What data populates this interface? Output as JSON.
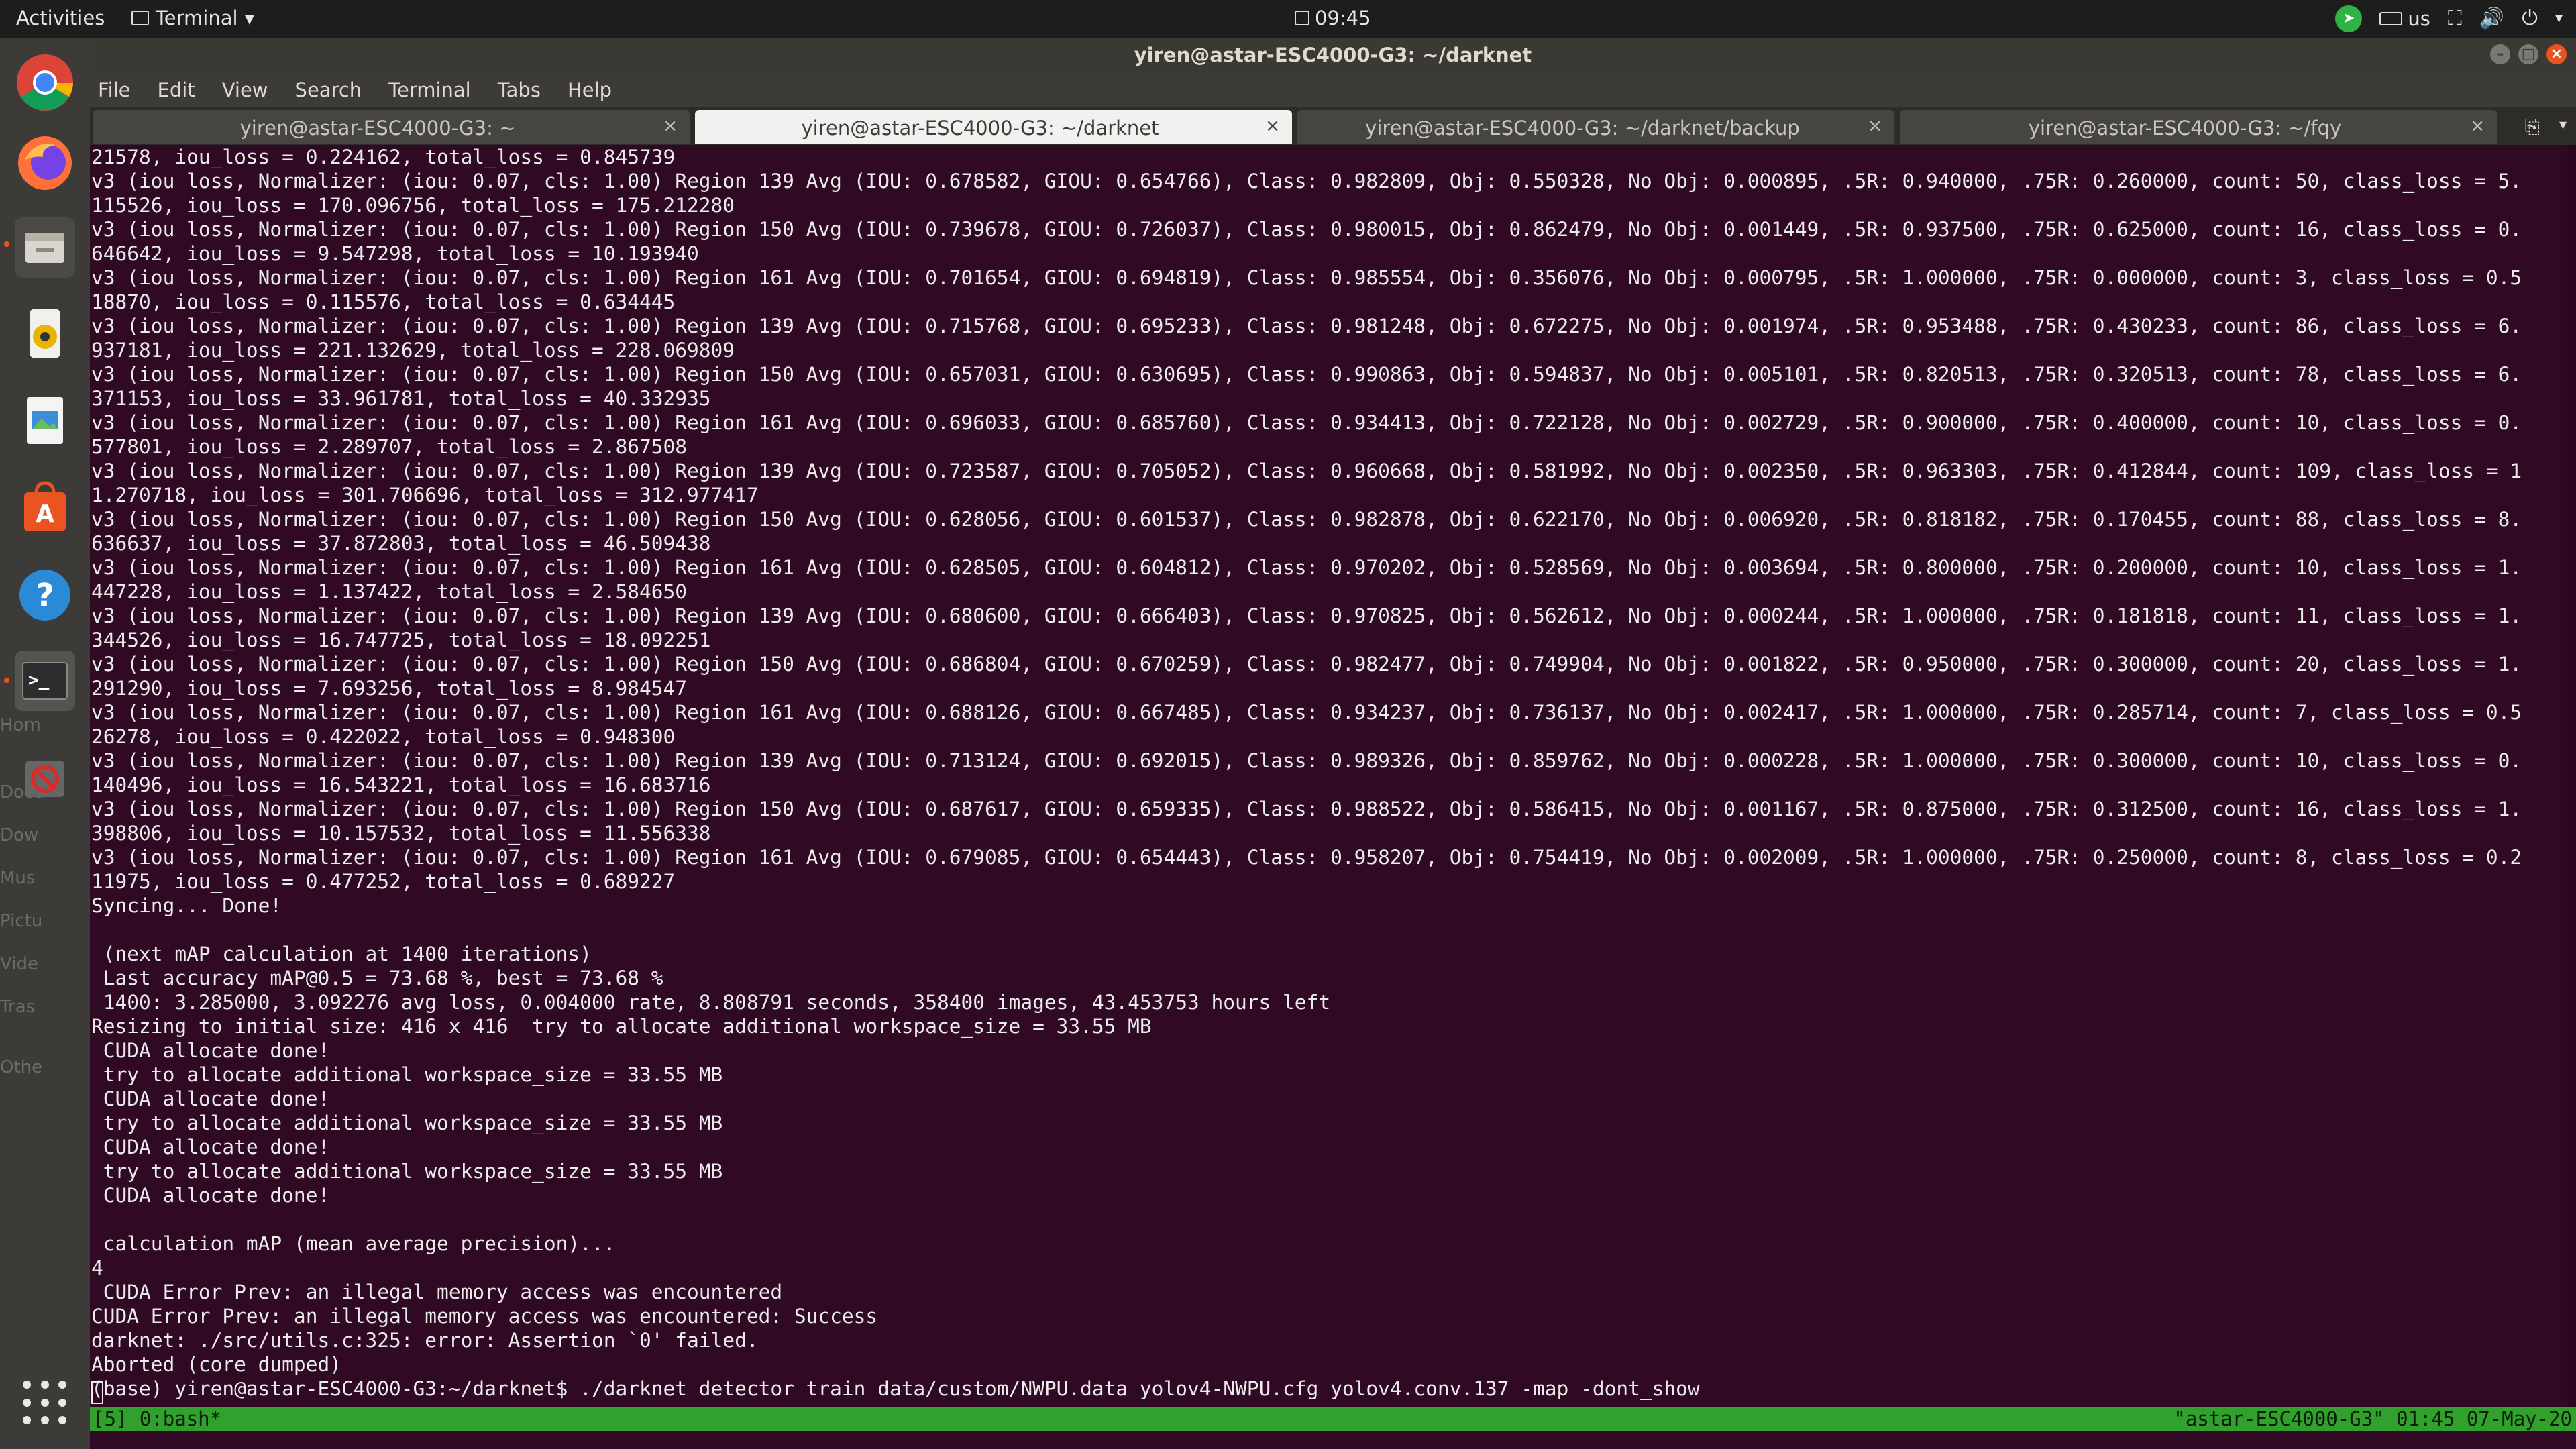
{
  "topbar": {
    "activities": "Activities",
    "app_menu": "Terminal",
    "clock": "09:45",
    "keyboard_layout": "us"
  },
  "dock": {
    "items": [
      "chrome-icon",
      "firefox-icon",
      "files-icon",
      "rhythmbox-icon",
      "image-viewer-icon",
      "software-center-icon",
      "help-icon",
      "terminal-icon",
      "blocked-icon"
    ],
    "ghost_labels": [
      "Hom",
      "Docu",
      "Dow",
      "Mus",
      "Pictu",
      "Vide",
      "Tras",
      "Othe"
    ]
  },
  "window": {
    "title": "yiren@astar-ESC4000-G3: ~/darknet",
    "menu": [
      "File",
      "Edit",
      "View",
      "Search",
      "Terminal",
      "Tabs",
      "Help"
    ],
    "tabs": [
      {
        "label": "yiren@astar-ESC4000-G3: ~",
        "active": false
      },
      {
        "label": "yiren@astar-ESC4000-G3: ~/darknet",
        "active": true
      },
      {
        "label": "yiren@astar-ESC4000-G3: ~/darknet/backup",
        "active": false
      },
      {
        "label": "yiren@astar-ESC4000-G3: ~/fqy",
        "active": false
      }
    ]
  },
  "terminal": {
    "lines": [
      "21578, iou_loss = 0.224162, total_loss = 0.845739",
      "v3 (iou loss, Normalizer: (iou: 0.07, cls: 1.00) Region 139 Avg (IOU: 0.678582, GIOU: 0.654766), Class: 0.982809, Obj: 0.550328, No Obj: 0.000895, .5R: 0.940000, .75R: 0.260000, count: 50, class_loss = 5.",
      "115526, iou_loss = 170.096756, total_loss = 175.212280",
      "v3 (iou loss, Normalizer: (iou: 0.07, cls: 1.00) Region 150 Avg (IOU: 0.739678, GIOU: 0.726037), Class: 0.980015, Obj: 0.862479, No Obj: 0.001449, .5R: 0.937500, .75R: 0.625000, count: 16, class_loss = 0.",
      "646642, iou_loss = 9.547298, total_loss = 10.193940",
      "v3 (iou loss, Normalizer: (iou: 0.07, cls: 1.00) Region 161 Avg (IOU: 0.701654, GIOU: 0.694819), Class: 0.985554, Obj: 0.356076, No Obj: 0.000795, .5R: 1.000000, .75R: 0.000000, count: 3, class_loss = 0.5",
      "18870, iou_loss = 0.115576, total_loss = 0.634445",
      "v3 (iou loss, Normalizer: (iou: 0.07, cls: 1.00) Region 139 Avg (IOU: 0.715768, GIOU: 0.695233), Class: 0.981248, Obj: 0.672275, No Obj: 0.001974, .5R: 0.953488, .75R: 0.430233, count: 86, class_loss = 6.",
      "937181, iou_loss = 221.132629, total_loss = 228.069809",
      "v3 (iou loss, Normalizer: (iou: 0.07, cls: 1.00) Region 150 Avg (IOU: 0.657031, GIOU: 0.630695), Class: 0.990863, Obj: 0.594837, No Obj: 0.005101, .5R: 0.820513, .75R: 0.320513, count: 78, class_loss = 6.",
      "371153, iou_loss = 33.961781, total_loss = 40.332935",
      "v3 (iou loss, Normalizer: (iou: 0.07, cls: 1.00) Region 161 Avg (IOU: 0.696033, GIOU: 0.685760), Class: 0.934413, Obj: 0.722128, No Obj: 0.002729, .5R: 0.900000, .75R: 0.400000, count: 10, class_loss = 0.",
      "577801, iou_loss = 2.289707, total_loss = 2.867508",
      "v3 (iou loss, Normalizer: (iou: 0.07, cls: 1.00) Region 139 Avg (IOU: 0.723587, GIOU: 0.705052), Class: 0.960668, Obj: 0.581992, No Obj: 0.002350, .5R: 0.963303, .75R: 0.412844, count: 109, class_loss = 1",
      "1.270718, iou_loss = 301.706696, total_loss = 312.977417",
      "v3 (iou loss, Normalizer: (iou: 0.07, cls: 1.00) Region 150 Avg (IOU: 0.628056, GIOU: 0.601537), Class: 0.982878, Obj: 0.622170, No Obj: 0.006920, .5R: 0.818182, .75R: 0.170455, count: 88, class_loss = 8.",
      "636637, iou_loss = 37.872803, total_loss = 46.509438",
      "v3 (iou loss, Normalizer: (iou: 0.07, cls: 1.00) Region 161 Avg (IOU: 0.628505, GIOU: 0.604812), Class: 0.970202, Obj: 0.528569, No Obj: 0.003694, .5R: 0.800000, .75R: 0.200000, count: 10, class_loss = 1.",
      "447228, iou_loss = 1.137422, total_loss = 2.584650",
      "v3 (iou loss, Normalizer: (iou: 0.07, cls: 1.00) Region 139 Avg (IOU: 0.680600, GIOU: 0.666403), Class: 0.970825, Obj: 0.562612, No Obj: 0.000244, .5R: 1.000000, .75R: 0.181818, count: 11, class_loss = 1.",
      "344526, iou_loss = 16.747725, total_loss = 18.092251",
      "v3 (iou loss, Normalizer: (iou: 0.07, cls: 1.00) Region 150 Avg (IOU: 0.686804, GIOU: 0.670259), Class: 0.982477, Obj: 0.749904, No Obj: 0.001822, .5R: 0.950000, .75R: 0.300000, count: 20, class_loss = 1.",
      "291290, iou_loss = 7.693256, total_loss = 8.984547",
      "v3 (iou loss, Normalizer: (iou: 0.07, cls: 1.00) Region 161 Avg (IOU: 0.688126, GIOU: 0.667485), Class: 0.934237, Obj: 0.736137, No Obj: 0.002417, .5R: 1.000000, .75R: 0.285714, count: 7, class_loss = 0.5",
      "26278, iou_loss = 0.422022, total_loss = 0.948300",
      "v3 (iou loss, Normalizer: (iou: 0.07, cls: 1.00) Region 139 Avg (IOU: 0.713124, GIOU: 0.692015), Class: 0.989326, Obj: 0.859762, No Obj: 0.000228, .5R: 1.000000, .75R: 0.300000, count: 10, class_loss = 0.",
      "140496, iou_loss = 16.543221, total_loss = 16.683716",
      "v3 (iou loss, Normalizer: (iou: 0.07, cls: 1.00) Region 150 Avg (IOU: 0.687617, GIOU: 0.659335), Class: 0.988522, Obj: 0.586415, No Obj: 0.001167, .5R: 0.875000, .75R: 0.312500, count: 16, class_loss = 1.",
      "398806, iou_loss = 10.157532, total_loss = 11.556338",
      "v3 (iou loss, Normalizer: (iou: 0.07, cls: 1.00) Region 161 Avg (IOU: 0.679085, GIOU: 0.654443), Class: 0.958207, Obj: 0.754419, No Obj: 0.002009, .5R: 1.000000, .75R: 0.250000, count: 8, class_loss = 0.2",
      "11975, iou_loss = 0.477252, total_loss = 0.689227",
      "Syncing... Done!",
      "",
      " (next mAP calculation at 1400 iterations)",
      " Last accuracy mAP@0.5 = 73.68 %, best = 73.68 %",
      " 1400: 3.285000, 3.092276 avg loss, 0.004000 rate, 8.808791 seconds, 358400 images, 43.453753 hours left",
      "Resizing to initial size: 416 x 416  try to allocate additional workspace_size = 33.55 MB",
      " CUDA allocate done!",
      " try to allocate additional workspace_size = 33.55 MB",
      " CUDA allocate done!",
      " try to allocate additional workspace_size = 33.55 MB",
      " CUDA allocate done!",
      " try to allocate additional workspace_size = 33.55 MB",
      " CUDA allocate done!",
      "",
      " calculation mAP (mean average precision)...",
      "4",
      " CUDA Error Prev: an illegal memory access was encountered",
      "CUDA Error Prev: an illegal memory access was encountered: Success",
      "darknet: ./src/utils.c:325: error: Assertion `0' failed.",
      "Aborted (core dumped)",
      "(base) yiren@astar-ESC4000-G3:~/darknet$ ./darknet detector train data/custom/NWPU.data yolov4-NWPU.cfg yolov4.conv.137 -map -dont_show"
    ],
    "tmux_left": "[5] 0:bash*",
    "tmux_right": "\"astar-ESC4000-G3\" 01:45 07-May-20"
  },
  "colors": {
    "terminal_bg": "#300a24",
    "accent": "#e95420",
    "tmux_status": "#2fa12c"
  }
}
